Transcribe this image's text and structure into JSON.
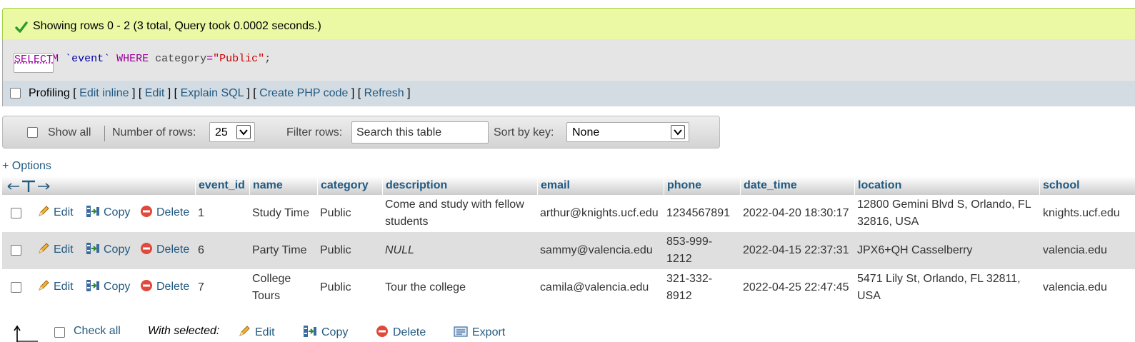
{
  "success": {
    "message": "Showing rows 0 - 2 (3 total, Query took 0.0002 seconds.)"
  },
  "sql": {
    "select": "SELECT",
    "star": "*",
    "from": "FROM",
    "table": "`event`",
    "where": "WHERE",
    "column": "category",
    "eq": "=",
    "value": "\"Public\"",
    "end": ";"
  },
  "profiling": {
    "label": "Profiling",
    "links": [
      "Edit inline",
      "Edit",
      "Explain SQL",
      "Create PHP code",
      "Refresh"
    ]
  },
  "navbar": {
    "show_all": "Show all",
    "rows_label": "Number of rows:",
    "rows_value": "25",
    "filter_label": "Filter rows:",
    "filter_placeholder": "Search this table",
    "sort_label": "Sort by key:",
    "sort_value": "None"
  },
  "options_link": "+ Options",
  "table": {
    "columns": [
      "event_id",
      "name",
      "category",
      "description",
      "email",
      "phone",
      "date_time",
      "location",
      "school"
    ],
    "actions": {
      "edit": "Edit",
      "copy": "Copy",
      "delete": "Delete"
    },
    "rows": [
      {
        "event_id": "1",
        "name": "Study Time",
        "category": "Public",
        "description": "Come and study with fellow students",
        "email": "arthur@knights.ucf.edu",
        "phone": "1234567891",
        "date_time": "2022-04-20 18:30:17",
        "location": "12800 Gemini Blvd S, Orlando, FL 32816, USA",
        "school": "knights.ucf.edu"
      },
      {
        "event_id": "6",
        "name": "Party Time",
        "category": "Public",
        "description": "NULL",
        "email": "sammy@valencia.edu",
        "phone": "853-999-1212",
        "date_time": "2022-04-15 22:37:31",
        "location": "JPX6+QH Casselberry",
        "school": "valencia.edu"
      },
      {
        "event_id": "7",
        "name": "College Tours",
        "category": "Public",
        "description": "Tour the college",
        "email": "camila@valencia.edu",
        "phone": "321-332-8912",
        "date_time": "2022-04-25 22:47:45",
        "location": "5471 Lily St, Orlando, FL 32811, USA",
        "school": "valencia.edu"
      }
    ]
  },
  "footer": {
    "check_all": "Check all",
    "with_selected": "With selected:",
    "edit": "Edit",
    "copy": "Copy",
    "delete": "Delete",
    "export": "Export"
  },
  "colors": {
    "success_bg": "#ebf8a4",
    "link": "#235a81",
    "sql_bg": "#e5e5e5",
    "profiling_bg": "#d3dce3"
  },
  "icons": [
    "check-icon",
    "pencil-icon",
    "copy-icon",
    "delete-icon",
    "export-icon",
    "arrow-up-icon"
  ]
}
